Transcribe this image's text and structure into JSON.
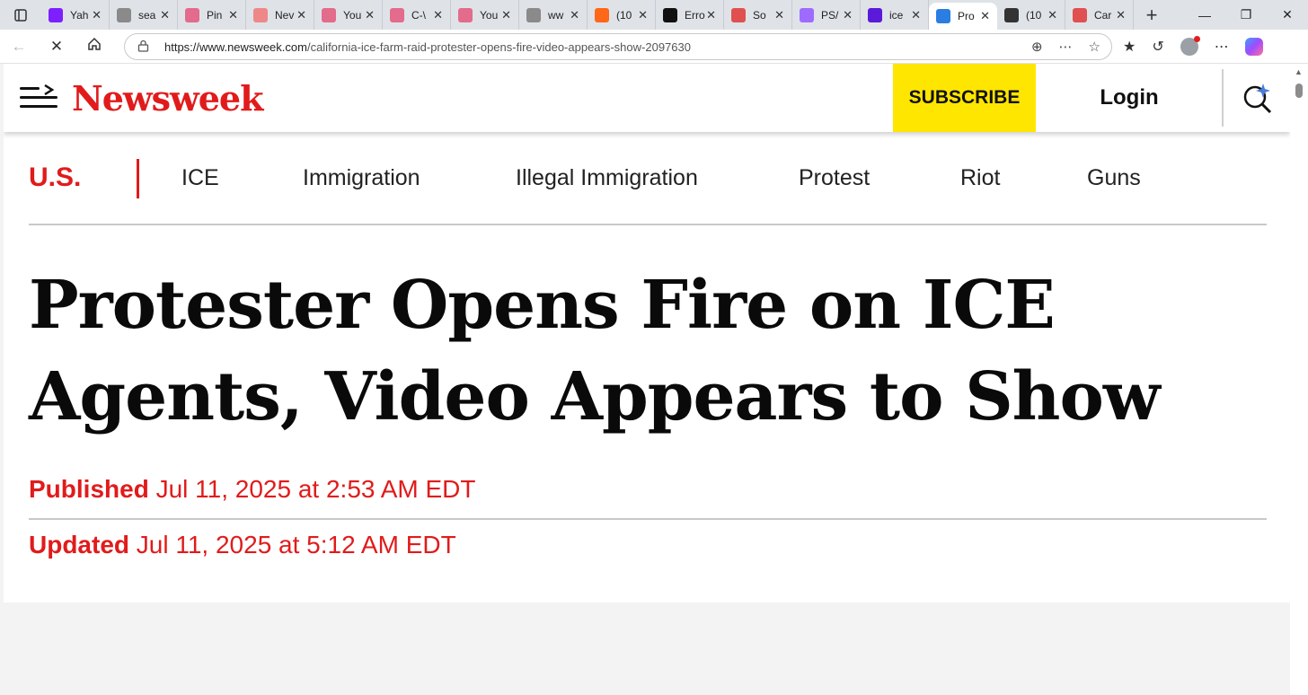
{
  "browser": {
    "tabs": [
      {
        "title": "Yah",
        "icon": "yahoo-icon",
        "color": "#7e1fff"
      },
      {
        "title": "sea",
        "icon": "doc-icon",
        "color": "#8a8a8a"
      },
      {
        "title": "Pin",
        "icon": "youtube-icon",
        "color": "#e36b8b"
      },
      {
        "title": "Nev",
        "icon": "news-icon",
        "color": "#e88"
      },
      {
        "title": "You",
        "icon": "youtube-icon",
        "color": "#e36b8b"
      },
      {
        "title": "C-\\",
        "icon": "youtube-icon",
        "color": "#e36b8b"
      },
      {
        "title": "You",
        "icon": "youtube-icon",
        "color": "#e36b8b"
      },
      {
        "title": "ww",
        "icon": "doc-icon",
        "color": "#8a8a8a"
      },
      {
        "title": "(10",
        "icon": "substack-icon",
        "color": "#ff6719"
      },
      {
        "title": "Erro",
        "icon": "error-site-icon",
        "color": "#111"
      },
      {
        "title": "So",
        "icon": "cd-icon",
        "color": "#e05050"
      },
      {
        "title": "PS/",
        "icon": "yahoo-icon",
        "color": "#9f6bff"
      },
      {
        "title": "ice",
        "icon": "yahoo-icon",
        "color": "#5b19d9"
      },
      {
        "title": "Pro",
        "icon": "loading-icon",
        "color": "#2a7de1"
      },
      {
        "title": "(10",
        "icon": "fp-icon",
        "color": "#333"
      },
      {
        "title": "Car",
        "icon": "star-site-icon",
        "color": "#e05050"
      }
    ],
    "close_glyph": "✕",
    "new_tab_glyph": "+",
    "url_host": "https://www.newsweek.com",
    "url_path": "/california-ice-farm-raid-protester-opens-fire-video-appears-show-2097630"
  },
  "site": {
    "logo": "Newsweek",
    "subscribe_label": "SUBSCRIBE",
    "login_label": "Login",
    "colors": {
      "brand_red": "#e11b1b",
      "subscribe_yellow": "#ffe600"
    }
  },
  "category_nav": {
    "primary": "U.S.",
    "tags": [
      "ICE",
      "Immigration",
      "Illegal Immigration",
      "Protest",
      "Riot",
      "Guns"
    ]
  },
  "article": {
    "headline": "Protester Opens Fire on ICE Agents, Video Appears to Show",
    "published_label": "Published",
    "published_date": "Jul 11, 2025 at 2:53 AM EDT",
    "updated_label": "Updated",
    "updated_date": "Jul 11, 2025 at 5:12 AM EDT"
  }
}
